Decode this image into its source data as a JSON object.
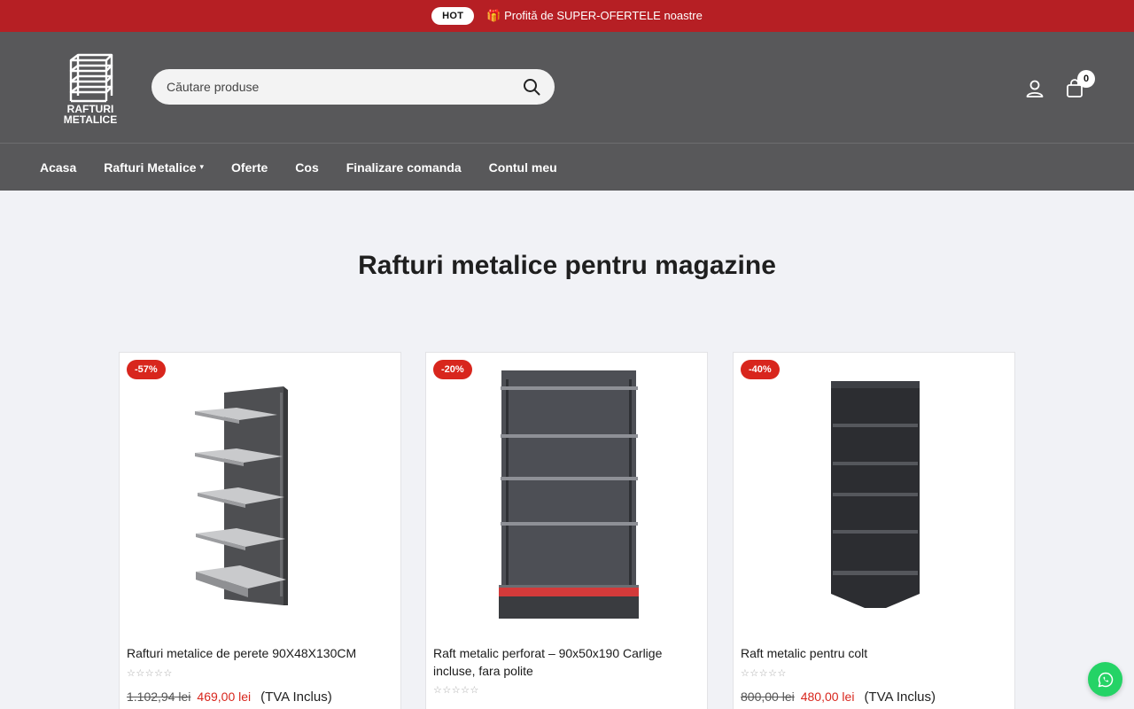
{
  "topbar": {
    "badge": "HOT",
    "promo_text": "🎁 Profită de SUPER-OFERTELE noastre"
  },
  "header": {
    "logo_line1": "RAFTURI",
    "logo_line2": "METALICE",
    "search_placeholder": "Căutare produse",
    "cart_count": "0"
  },
  "nav": {
    "items": [
      {
        "label": "Acasa"
      },
      {
        "label": "Rafturi Metalice"
      },
      {
        "label": "Oferte"
      },
      {
        "label": "Cos"
      },
      {
        "label": "Finalizare comanda"
      },
      {
        "label": "Contul meu"
      }
    ]
  },
  "page": {
    "title": "Rafturi metalice pentru magazine"
  },
  "products": [
    {
      "badge": "-57%",
      "title": "Rafturi metalice de perete 90X48X130CM",
      "old_price": "1.102,94 lei",
      "new_price": "469,00 lei",
      "vat": "(TVA Inclus)"
    },
    {
      "badge": "-20%",
      "title": "Raft metalic perforat – 90x50x190 Carlige incluse, fara polite"
    },
    {
      "badge": "-40%",
      "title": "Raft metalic pentru colt",
      "old_price": "800,00 lei",
      "new_price": "480,00 lei",
      "vat": "(TVA Inclus)"
    }
  ],
  "colors": {
    "topbar_bg": "#b61f24",
    "header_bg": "#58585a",
    "sale_red": "#d8261d",
    "whatsapp_green": "#25d366"
  },
  "icons": {
    "search": "search-icon",
    "user": "user-icon",
    "cart": "shopping-bag-icon",
    "whatsapp": "whatsapp-icon"
  }
}
